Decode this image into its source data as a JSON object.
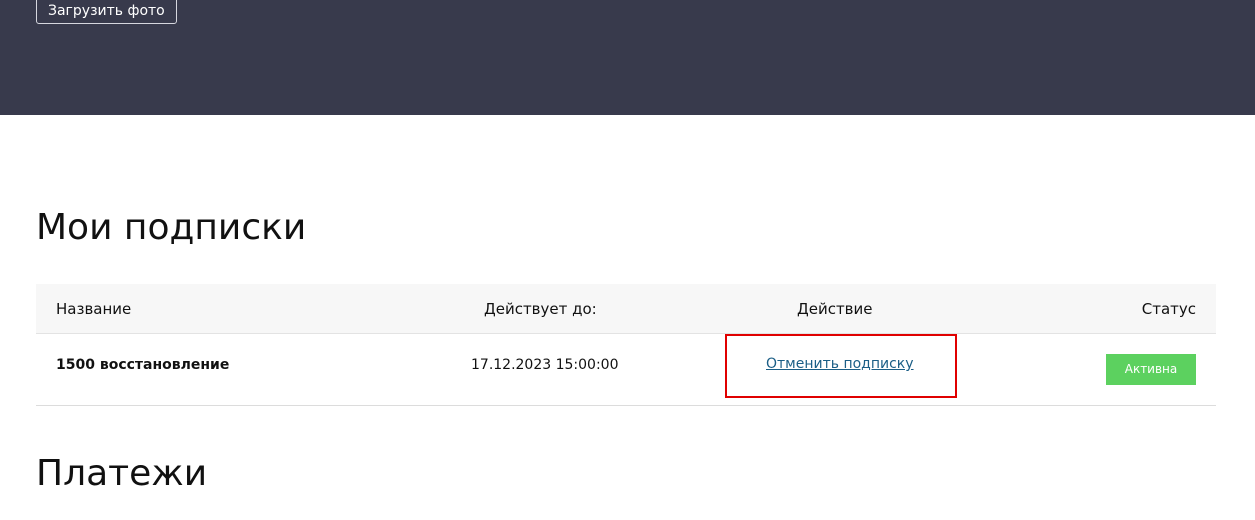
{
  "header": {
    "upload_photo_label": "Загрузить фото"
  },
  "subscriptions": {
    "title": "Мои подписки",
    "columns": {
      "name": "Название",
      "valid_until": "Действует до:",
      "action": "Действие",
      "status": "Статус"
    },
    "rows": [
      {
        "name": "1500 восстановление",
        "valid_until": "17.12.2023 15:00:00",
        "action": "Отменить подписку",
        "status": "Активна"
      }
    ]
  },
  "payments": {
    "title": "Платежи"
  },
  "colors": {
    "header_bg": "#383a4c",
    "link": "#1b5e86",
    "status_active": "#5cd15f",
    "highlight": "#e00000"
  }
}
